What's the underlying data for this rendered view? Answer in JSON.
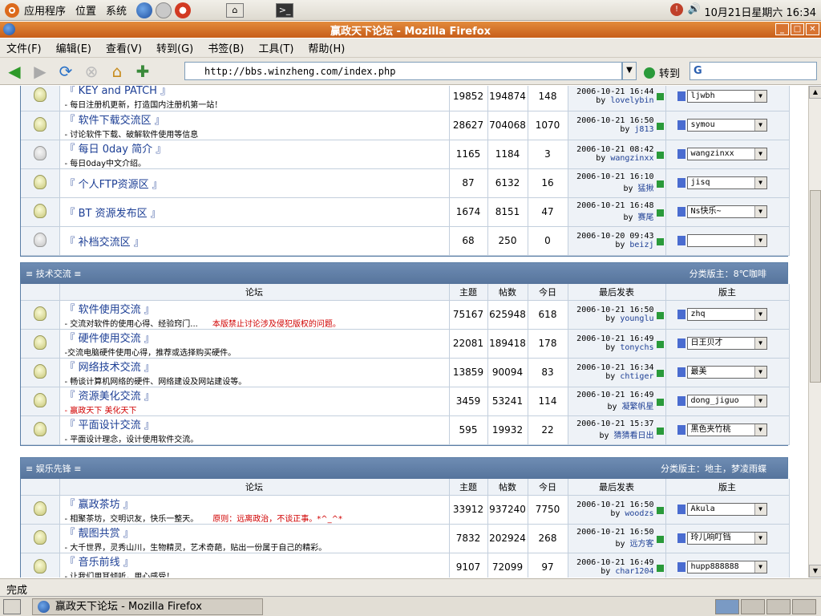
{
  "desktop": {
    "menus": [
      "应用程序",
      "位置",
      "系统"
    ],
    "clock": "10月21日星期六 16:34"
  },
  "window": {
    "title": "赢政天下论坛 - Mozilla Firefox"
  },
  "menubar": [
    "文件(F)",
    "编辑(E)",
    "查看(V)",
    "转到(G)",
    "书签(B)",
    "工具(T)",
    "帮助(H)"
  ],
  "toolbar": {
    "url": "http://bbs.winzheng.com/index.php",
    "go_label": "转到",
    "search_prefix": "G"
  },
  "status": "完成",
  "taskbar": {
    "item": "赢政天下论坛 - Mozilla Firefox"
  },
  "columns": {
    "forum": "论坛",
    "topics": "主题",
    "posts": "帖数",
    "today": "今日",
    "last": "最后发表",
    "mod": "版主"
  },
  "sections": [
    {
      "title": "",
      "mods": "",
      "forums": [
        {
          "name": "『 KEY and PATCH 』",
          "desc": "- 每日注册机更新，打造国内注册机第一站！",
          "topics": "19852",
          "posts": "194874",
          "today": "148",
          "time": "2006-10-21 16:44",
          "by": "lovelybin",
          "mod": "ljwbh",
          "off": false
        },
        {
          "name": "『 软件下载交流区 』",
          "desc": "- 讨论软件下载、破解软件使用等信息",
          "topics": "28627",
          "posts": "704068",
          "today": "1070",
          "time": "2006-10-21 16:50",
          "by": "j813",
          "mod": "symou",
          "off": false
        },
        {
          "name": "『 每日 0day 简介 』",
          "desc": "- 每日0day中文介绍。",
          "topics": "1165",
          "posts": "1184",
          "today": "3",
          "time": "2006-10-21 08:42",
          "by": "wangzinxx",
          "mod": "wangzinxx",
          "off": true
        },
        {
          "name": "『 个人FTP资源区 』",
          "desc": "",
          "topics": "87",
          "posts": "6132",
          "today": "16",
          "time": "2006-10-21 16:10",
          "by": "猛揪",
          "mod": "jisq",
          "off": false
        },
        {
          "name": "『 BT 资源发布区 』",
          "desc": "",
          "topics": "1674",
          "posts": "8151",
          "today": "47",
          "time": "2006-10-21 16:48",
          "by": "赛尾",
          "mod": "Ns快乐~",
          "off": false
        },
        {
          "name": "『 补档交流区 』",
          "desc": "",
          "topics": "68",
          "posts": "250",
          "today": "0",
          "time": "2006-10-20 09:43",
          "by": "beizj",
          "mod": "",
          "off": true
        }
      ]
    },
    {
      "title": "技术交流",
      "mods": "分类版主：8℃咖啡",
      "forums": [
        {
          "name": "『 软件使用交流 』",
          "desc": "- 交流对软件的使用心得、经验窍门...",
          "warn": "本版禁止讨论涉及侵犯版权的问题。",
          "topics": "75167",
          "posts": "625948",
          "today": "618",
          "time": "2006-10-21 16:50",
          "by": "younglu",
          "mod": "zhq",
          "off": false
        },
        {
          "name": "『 硬件使用交流 』",
          "desc": "-交流电脑硬件使用心得，推荐或选择购买硬件。",
          "topics": "22081",
          "posts": "189418",
          "today": "178",
          "time": "2006-10-21 16:49",
          "by": "tonychs",
          "mod": "日王贝才",
          "off": false
        },
        {
          "name": "『 网络技术交流 』",
          "desc": "- 畅谈计算机网络的硬件、网络建设及网站建设等。",
          "topics": "13859",
          "posts": "90094",
          "today": "83",
          "time": "2006-10-21 16:34",
          "by": "chtiger",
          "mod": "最美",
          "off": false
        },
        {
          "name": "『 资源美化交流 』",
          "desc": "- 赢政天下 美化天下",
          "desc_red": true,
          "topics": "3459",
          "posts": "53241",
          "today": "114",
          "time": "2006-10-21 16:49",
          "by": "凝繁帆星",
          "mod": "dong_jiguo",
          "off": false
        },
        {
          "name": "『 平面设计交流 』",
          "desc": "- 平面设计理念，设计使用软件交流。",
          "topics": "595",
          "posts": "19932",
          "today": "22",
          "time": "2006-10-21 15:37",
          "by": "猜猜看日出",
          "mod": "黑色夹竹桃",
          "off": false
        }
      ]
    },
    {
      "title": "娱乐先锋",
      "mods": "分类版主：地主，梦凌雨蝶",
      "forums": [
        {
          "name": "『 赢政茶坊 』",
          "desc": "- 相聚茶坊，交明识友，快乐一整天。",
          "warn": "原则：远离政治，不谈正事。*^_^*",
          "topics": "33912",
          "posts": "937240",
          "today": "7750",
          "time": "2006-10-21 16:50",
          "by": "woodzs",
          "mod": "Akula",
          "off": false
        },
        {
          "name": "『 靓图共赏 』",
          "desc": "- 大千世界，灵秀山川，生物精灵，艺术奇葩，贴出一份属于自己的精彩。",
          "topics": "7832",
          "posts": "202924",
          "today": "268",
          "time": "2006-10-21 16:50",
          "by": "远方客",
          "mod": "玲儿响叮铛",
          "off": false
        },
        {
          "name": "『 音乐前线 』",
          "desc": "- 让我们用耳倾听，用心感受！",
          "topics": "9107",
          "posts": "72099",
          "today": "97",
          "time": "2006-10-21 16:49",
          "by": "char1204",
          "mod": "hupp888888",
          "off": false
        }
      ]
    }
  ]
}
